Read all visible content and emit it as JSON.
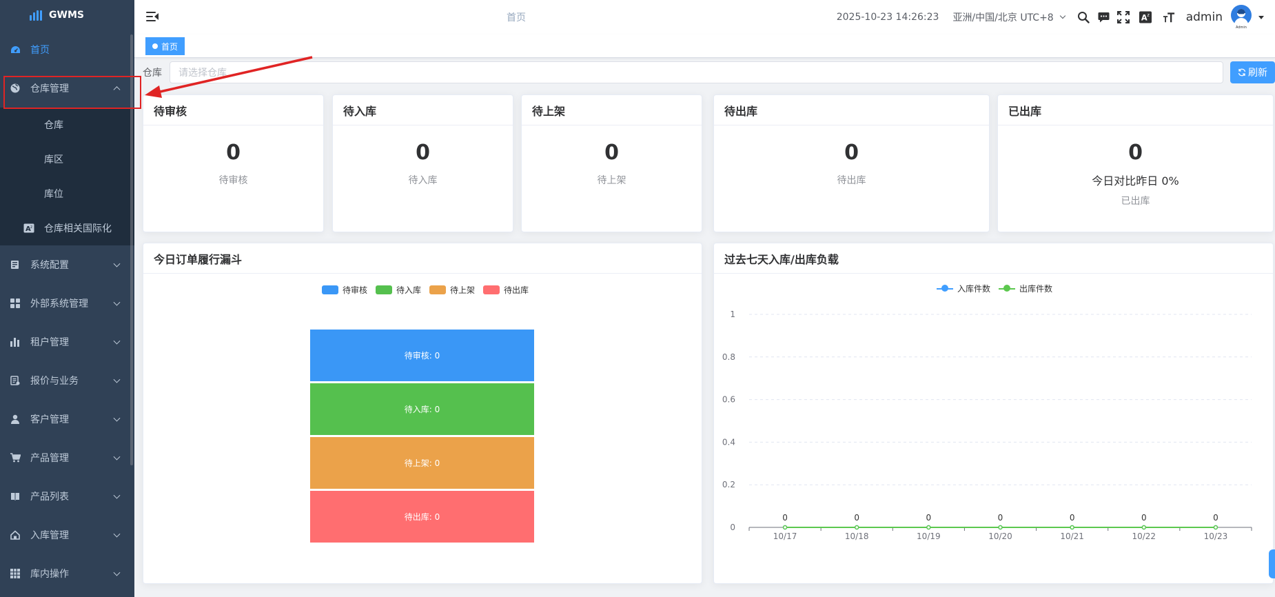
{
  "app": {
    "logo_text": "GWMS"
  },
  "sidebar": {
    "items": [
      {
        "label": "首页",
        "icon": "dashboard-icon",
        "active": true
      },
      {
        "label": "仓库管理",
        "icon": "globe-icon",
        "expanded": true,
        "children": [
          {
            "label": "仓库"
          },
          {
            "label": "库区"
          },
          {
            "label": "库位"
          },
          {
            "label": "仓库相关国际化",
            "icon": "translate-icon"
          }
        ]
      },
      {
        "label": "系统配置",
        "icon": "server-icon"
      },
      {
        "label": "外部系统管理",
        "icon": "grid-icon"
      },
      {
        "label": "租户管理",
        "icon": "bar-chart-icon"
      },
      {
        "label": "报价与业务",
        "icon": "document-icon"
      },
      {
        "label": "客户管理",
        "icon": "user-icon"
      },
      {
        "label": "产品管理",
        "icon": "cart-icon"
      },
      {
        "label": "产品列表",
        "icon": "book-icon"
      },
      {
        "label": "入库管理",
        "icon": "home-icon"
      },
      {
        "label": "库内操作",
        "icon": "table-icon"
      }
    ]
  },
  "navbar": {
    "title": "首页",
    "datetime": "2025-10-23 14:26:23",
    "timezone": "亚洲/中国/北京 UTC+8",
    "username": "admin",
    "avatar_label": "Admin"
  },
  "tags": {
    "active": "首页"
  },
  "filter": {
    "label": "仓库",
    "placeholder": "请选择仓库",
    "refresh_label": "刷新"
  },
  "stats": [
    {
      "title": "待审核",
      "value": "0",
      "label": "待审核"
    },
    {
      "title": "待入库",
      "value": "0",
      "label": "待入库"
    },
    {
      "title": "待上架",
      "value": "0",
      "label": "待上架"
    },
    {
      "title": "待出库",
      "value": "0",
      "label": "待出库"
    },
    {
      "title": "已出库",
      "value": "0",
      "compare": "今日对比昨日 0%",
      "label": "已出库"
    }
  ],
  "funnel_card": {
    "title": "今日订单履行漏斗"
  },
  "line_card": {
    "title": "过去七天入库/出库负载"
  },
  "colors": {
    "accent": "#409eff",
    "green": "#5cc84e",
    "orange": "#eba24a",
    "red": "#ff6e70",
    "sidebar": "#304156"
  },
  "chart_data": [
    {
      "type": "funnel",
      "title": "今日订单履行漏斗",
      "legend": [
        "待审核",
        "待入库",
        "待上架",
        "待出库"
      ],
      "series": [
        {
          "name": "待审核",
          "value": 0,
          "label": "待审核: 0",
          "color": "#3a97f6"
        },
        {
          "name": "待入库",
          "value": 0,
          "label": "待入库: 0",
          "color": "#55c04e"
        },
        {
          "name": "待上架",
          "value": 0,
          "label": "待上架: 0",
          "color": "#eba24a"
        },
        {
          "name": "待出库",
          "value": 0,
          "label": "待出库: 0",
          "color": "#ff6e70"
        }
      ]
    },
    {
      "type": "line",
      "title": "过去七天入库/出库负载",
      "categories": [
        "10/17",
        "10/18",
        "10/19",
        "10/20",
        "10/21",
        "10/22",
        "10/23"
      ],
      "series": [
        {
          "name": "入库件数",
          "values": [
            0,
            0,
            0,
            0,
            0,
            0,
            0
          ],
          "color": "#409eff"
        },
        {
          "name": "出库件数",
          "values": [
            0,
            0,
            0,
            0,
            0,
            0,
            0
          ],
          "color": "#5cc84e"
        }
      ],
      "ylim": [
        0,
        1
      ],
      "yticks": [
        "0",
        "0.2",
        "0.4",
        "0.6",
        "0.8",
        "1"
      ],
      "data_labels": [
        "0",
        "0",
        "0",
        "0",
        "0",
        "0",
        "0"
      ],
      "legend_position": "top-center",
      "grid": true
    }
  ]
}
